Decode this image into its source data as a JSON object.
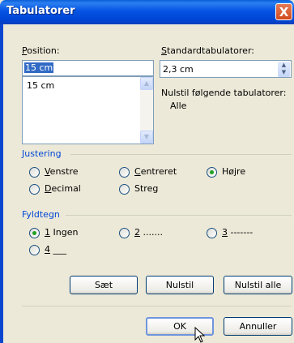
{
  "window": {
    "title": "Tabulatorer",
    "close_glyph": "X"
  },
  "position": {
    "label": "Position:",
    "value": "15 cm",
    "list_items": [
      "15 cm"
    ]
  },
  "standard": {
    "label": "Standardtabulatorer:",
    "value": "2,3 cm"
  },
  "clear_info": {
    "label": "Nulstil følgende tabulatorer:",
    "value": "Alle"
  },
  "alignment": {
    "title": "Justering",
    "options": [
      "Venstre",
      "Centreret",
      "Højre",
      "Decimal",
      "Streg"
    ],
    "selected": "Højre"
  },
  "leader": {
    "title": "Fyldtegn",
    "options": [
      "1 Ingen",
      "2 .......",
      "3 -------",
      "4 ___"
    ],
    "selected": "1 Ingen"
  },
  "buttons": {
    "set": "Sæt",
    "clear": "Nulstil",
    "clear_all": "Nulstil alle",
    "ok": "OK",
    "cancel": "Annuller"
  },
  "icons": {
    "close": "close-icon",
    "spin": "spin-up-down-icon",
    "scroll_up": "chevron-up-icon",
    "scroll_down": "chevron-down-icon",
    "cursor": "mouse-pointer-icon"
  },
  "colors": {
    "title_bar": "#0054e3",
    "group_title": "#0046d5",
    "dialog_bg": "#ece9d8",
    "selection": "#316ac5",
    "radio_dot": "#21a121"
  }
}
